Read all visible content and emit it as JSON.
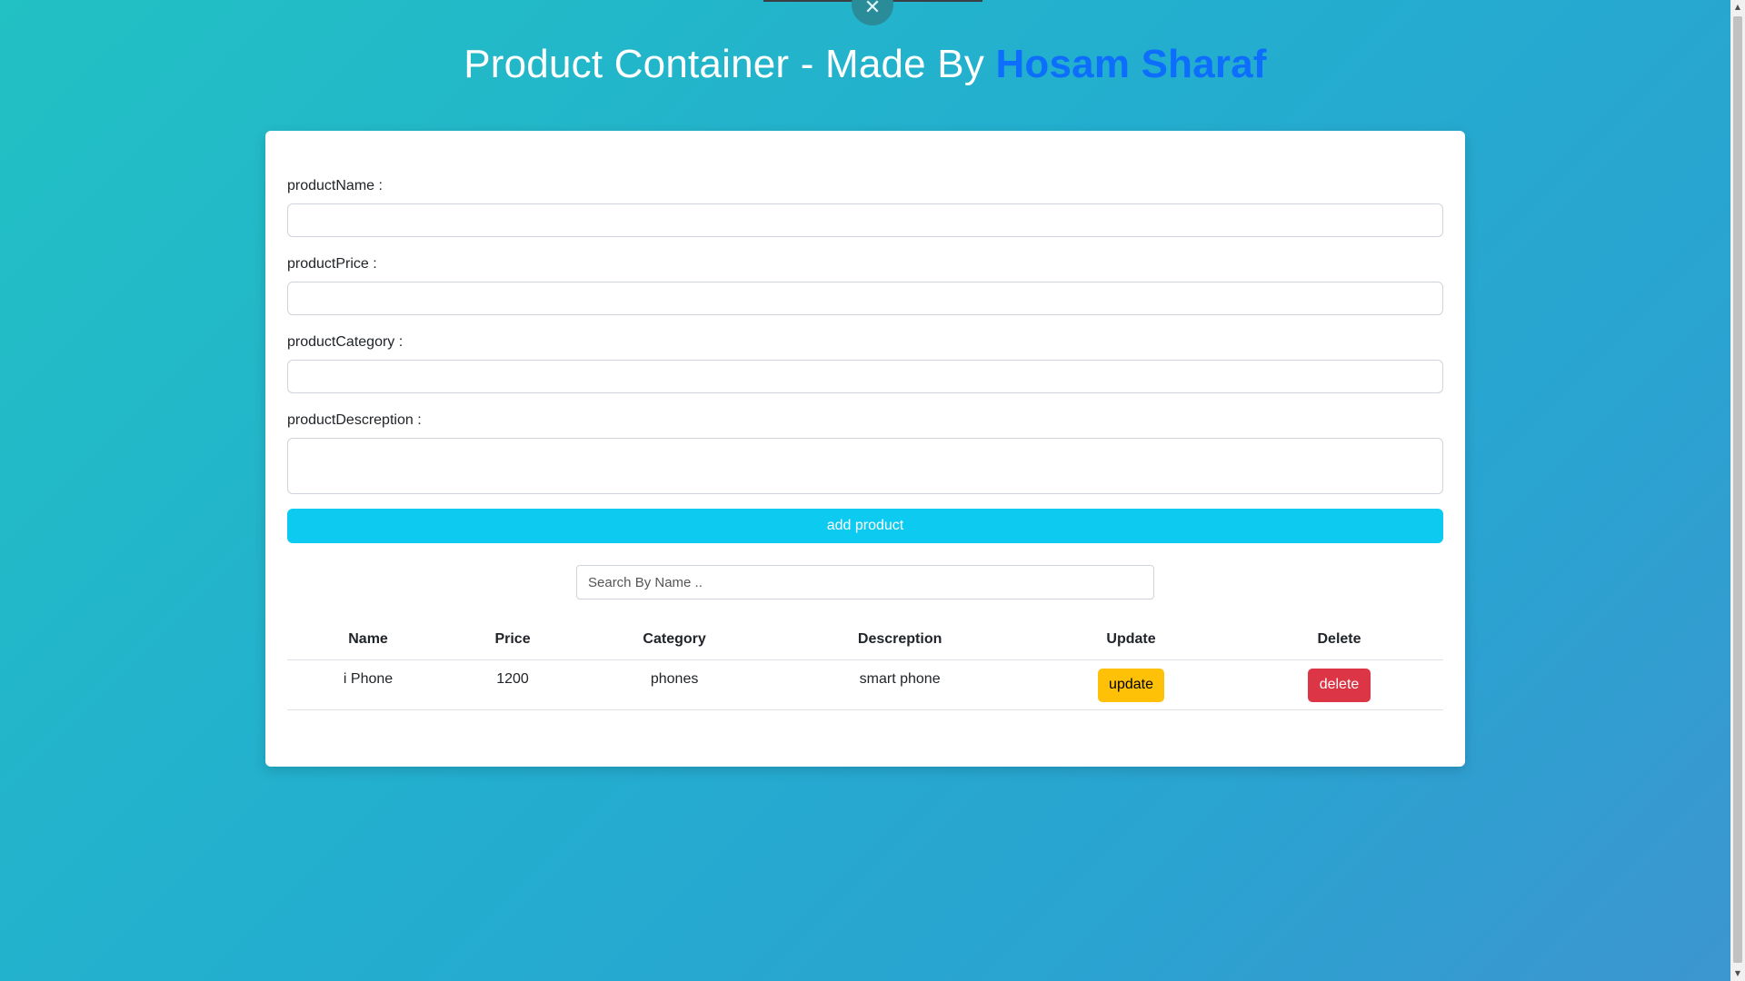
{
  "header": {
    "title_prefix": "Product Container - Made By ",
    "author": "Hosam Sharaf",
    "close_glyph": "✕"
  },
  "form": {
    "name_label": "productName :",
    "name_value": "",
    "price_label": "productPrice :",
    "price_value": "",
    "category_label": "productCategory :",
    "category_value": "",
    "description_label": "productDescreption :",
    "description_value": "",
    "add_button": "add product"
  },
  "search": {
    "placeholder": "Search By Name .."
  },
  "table": {
    "headers": [
      "Name",
      "Price",
      "Category",
      "Descreption",
      "Update",
      "Delete"
    ],
    "rows": [
      {
        "name": "i Phone",
        "price": "1200",
        "category": "phones",
        "description": "smart phone",
        "update_label": "update",
        "delete_label": "delete"
      }
    ]
  },
  "colors": {
    "author": "#0d6efd",
    "add_button": "#0dcaf0",
    "update_button": "#ffc107",
    "delete_button": "#dc3545"
  },
  "icons": {
    "close": "close-icon",
    "scroll_up": "chevron-up-icon",
    "scroll_down": "chevron-down-icon"
  }
}
